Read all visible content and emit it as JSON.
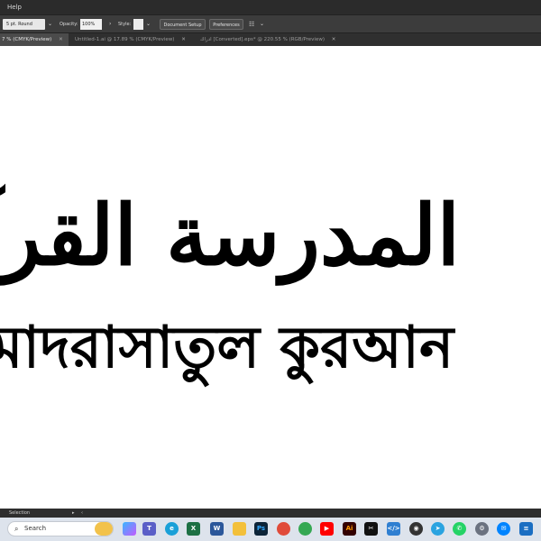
{
  "menu": {
    "help": "Help"
  },
  "controlbar": {
    "stroke_value": "5 pt. Round",
    "opacity_label": "Opacity:",
    "opacity_value": "100%",
    "style_label": "Style:",
    "document_setup": "Document Setup",
    "preferences": "Preferences"
  },
  "tabs": [
    {
      "label": "7 % (CMYK/Preview)",
      "active": true
    },
    {
      "label": "Untitled-1.ai @ 17.89 % (CMYK/Preview)",
      "active": false
    },
    {
      "label": "ادراك [Converted].eps* @ 220.55 % (RGB/Preview)",
      "active": false
    }
  ],
  "artwork": {
    "arabic": "المدرسة القرآن",
    "bengali": "মাদরাসাতুল কুরআন"
  },
  "status": {
    "tool": "Selection"
  },
  "taskbar": {
    "search_placeholder": "Search",
    "icons": [
      "copilot-icon",
      "teams-icon",
      "edge-icon",
      "excel-icon",
      "word-icon",
      "file-explorer-icon",
      "photoshop-icon",
      "chrome-icon",
      "chrome-alt-icon",
      "youtube-icon",
      "illustrator-icon",
      "capcut-icon",
      "vscode-icon",
      "obs-icon",
      "telegram-icon",
      "whatsapp-icon",
      "settings-icon",
      "messenger-icon",
      "notes-icon"
    ]
  }
}
